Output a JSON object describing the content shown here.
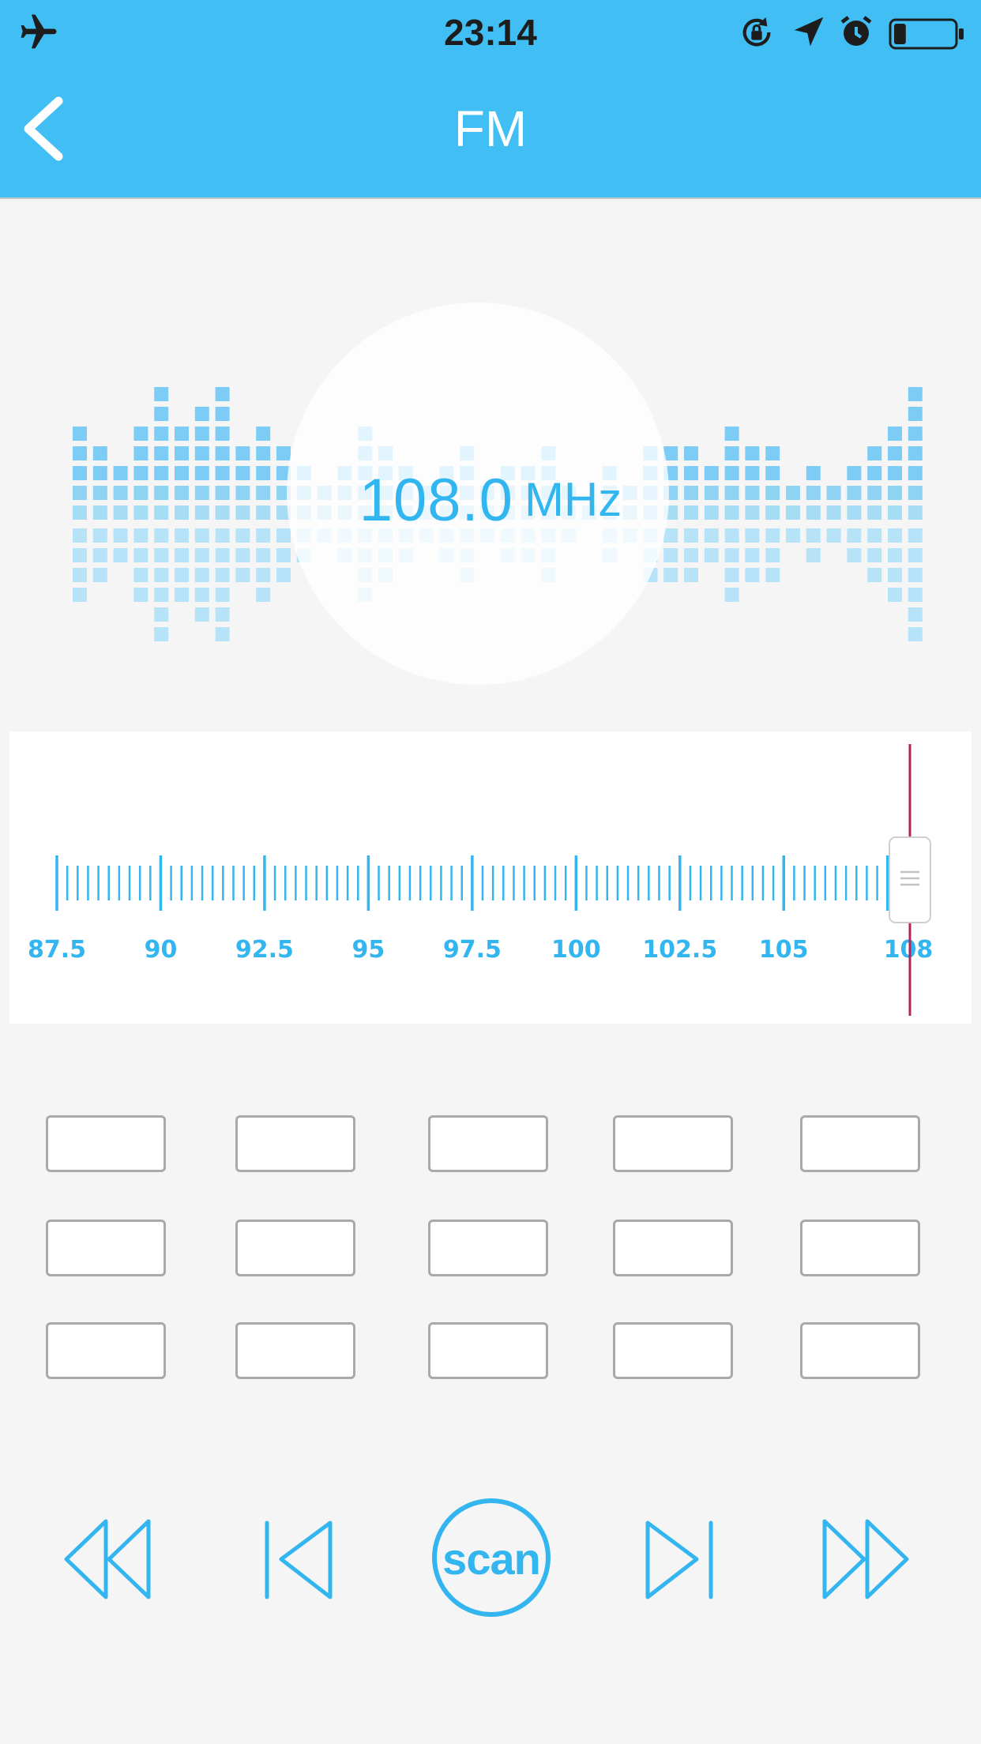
{
  "status_bar": {
    "time": "23:14",
    "icons": [
      "airplane-icon",
      "rotation-lock-icon",
      "location-arrow-icon",
      "alarm-icon",
      "battery-icon"
    ],
    "battery_level": 0.2
  },
  "nav": {
    "title": "FM",
    "back_icon": "chevron-left-icon"
  },
  "tuner": {
    "frequency": "108.0",
    "unit": "MHz",
    "current_frequency": 108.0
  },
  "dial": {
    "min": 87.5,
    "max": 108,
    "labels": [
      "87.5",
      "90",
      "92.5",
      "95",
      "97.5",
      "100",
      "102.5",
      "105",
      "108"
    ]
  },
  "presets": {
    "rows": 3,
    "cols": 5,
    "labels": [
      "",
      "",
      "",
      "",
      "",
      "",
      "",
      "",
      "",
      "",
      "",
      "",
      "",
      "",
      ""
    ]
  },
  "controls": {
    "scan_label": "scan",
    "icons": [
      "rewind-icon",
      "previous-icon",
      "scan-button",
      "next-icon",
      "fast-forward-icon"
    ]
  },
  "colors": {
    "accent": "#41bff5",
    "accent_dark": "#33b5ef",
    "needle": "#b0245c",
    "background": "#f5f5f5"
  }
}
